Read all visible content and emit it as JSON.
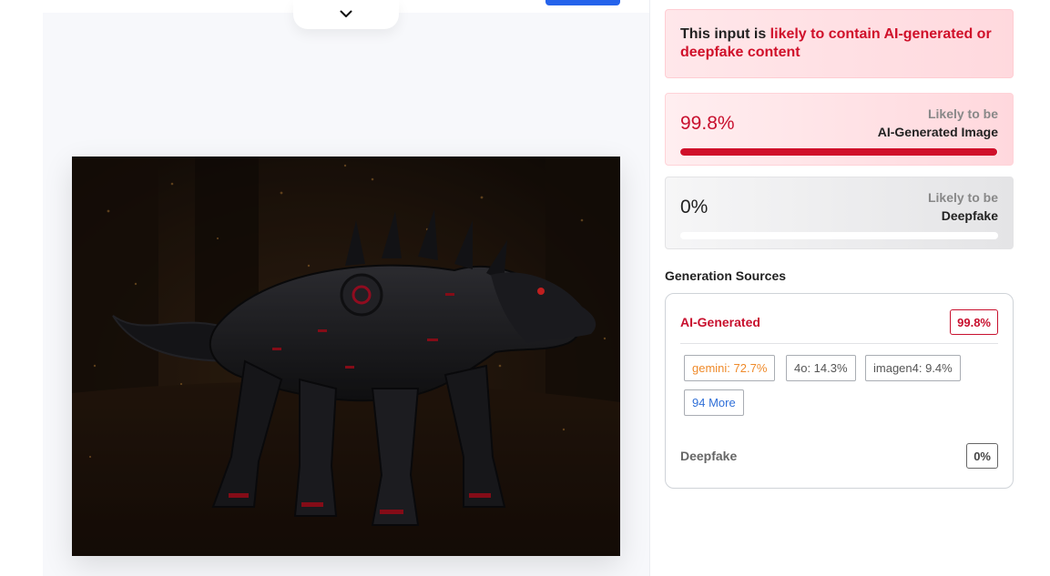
{
  "verdict": {
    "prefix": "This input is ",
    "highlight": "likely to contain AI-generated or deepfake content"
  },
  "scores": {
    "ai": {
      "percent_text": "99.8%",
      "value": 0.998,
      "caption_sub": "Likely to be",
      "caption_main": "AI-Generated Image",
      "color": "#d0102a"
    },
    "deepfake": {
      "percent_text": "0%",
      "value": 0,
      "caption_sub": "Likely to be",
      "caption_main": "Deepfake"
    }
  },
  "sources": {
    "title": "Generation Sources",
    "ai_label": "AI-Generated",
    "ai_badge": "99.8%",
    "models": [
      {
        "label": "gemini: 72.7%",
        "color": "#ef8a2a"
      },
      {
        "label": "4o: 14.3%"
      },
      {
        "label": "imagen4: 9.4%"
      }
    ],
    "more_label": "94 More",
    "deepfake_label": "Deepfake",
    "deepfake_badge": "0%"
  },
  "colors": {
    "accent_red": "#c8102e",
    "link_blue": "#2f6fd8",
    "primary_button": "#2563eb"
  },
  "icons": {
    "collapse": "chevron-down-icon"
  }
}
